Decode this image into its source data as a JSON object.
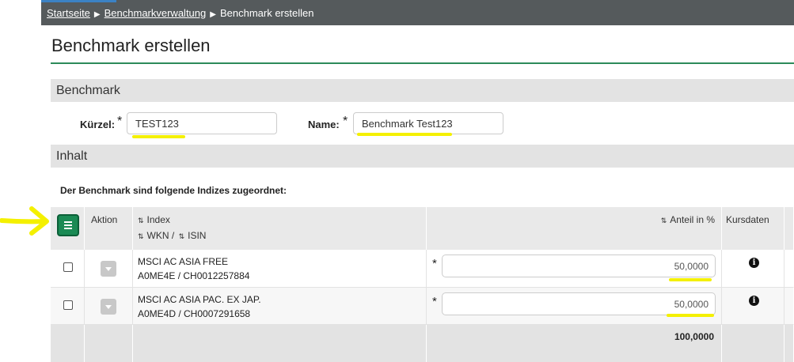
{
  "breadcrumb": {
    "home": "Startseite",
    "section": "Benchmarkverwaltung",
    "current": "Benchmark erstellen",
    "separator": "▶"
  },
  "page": {
    "title": "Benchmark erstellen"
  },
  "benchmark_section": {
    "heading": "Benchmark",
    "kuerzel_label": "Kürzel:",
    "kuerzel_value": "TEST123",
    "name_label": "Name:",
    "name_value": "Benchmark Test123",
    "required_mark": "*"
  },
  "content_section": {
    "heading": "Inhalt",
    "intro": "Der Benchmark sind folgende Indizes zugeordnet:"
  },
  "table": {
    "headers": {
      "aktion": "Aktion",
      "index": "Index",
      "wkn": "WKN /",
      "isin": "ISIN",
      "anteil": "Anteil in %",
      "kursdaten": "Kursdaten",
      "sort_icon": "⇅"
    },
    "rows": [
      {
        "index": "MSCI AC ASIA FREE",
        "ids": "A0ME4E / CH0012257884",
        "anteil": "50,0000",
        "info": "i"
      },
      {
        "index": "MSCI AC ASIA PAC. EX JAP.",
        "ids": "A0ME4D / CH0007291658",
        "anteil": "50,0000",
        "info": "i"
      }
    ],
    "total": "100,0000"
  },
  "colors": {
    "topbar": "#555a5c",
    "accent_green": "#1a8a54",
    "highlight": "#f4f000",
    "arrow": "#f4f000"
  },
  "icons": {
    "menu": "hamburger-icon",
    "sort": "sort-icon",
    "dropdown": "caret-down-icon",
    "info": "info-icon",
    "annotation": "arrow-right-icon"
  }
}
